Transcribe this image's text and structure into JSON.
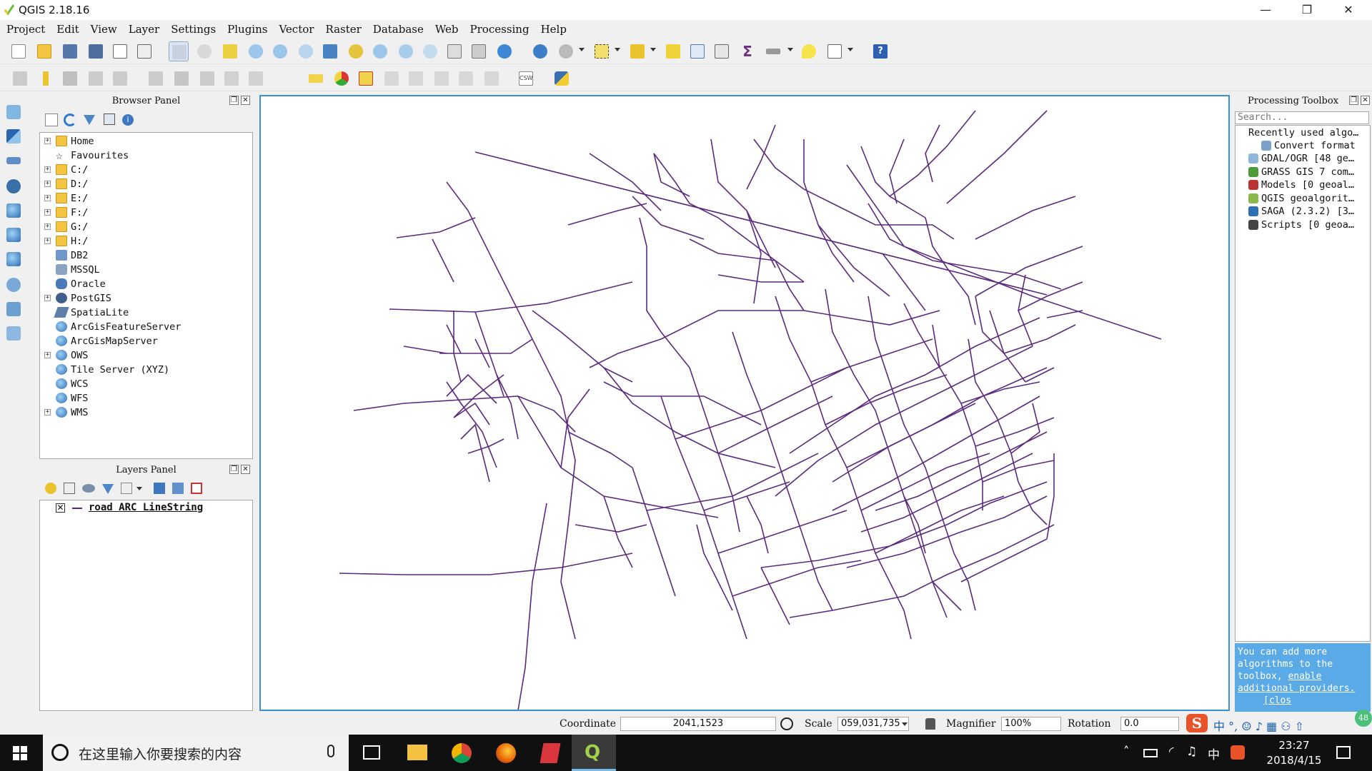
{
  "window": {
    "title": "QGIS 2.18.16",
    "minimize": "—",
    "maximize": "❐",
    "close": "✕"
  },
  "menu": [
    "Project",
    "Edit",
    "View",
    "Layer",
    "Settings",
    "Plugins",
    "Vector",
    "Raster",
    "Database",
    "Web",
    "Processing",
    "Help"
  ],
  "browser_panel": {
    "title": "Browser Panel",
    "items": [
      {
        "label": "Home",
        "icon": "folder-icon",
        "expand": true
      },
      {
        "label": "Favourites",
        "icon": "star-icon",
        "expand": false
      },
      {
        "label": "C:/",
        "icon": "folder-icon",
        "expand": true
      },
      {
        "label": "D:/",
        "icon": "folder-icon",
        "expand": true
      },
      {
        "label": "E:/",
        "icon": "folder-icon",
        "expand": true
      },
      {
        "label": "F:/",
        "icon": "folder-icon",
        "expand": true
      },
      {
        "label": "G:/",
        "icon": "folder-icon",
        "expand": true
      },
      {
        "label": "H:/",
        "icon": "folder-icon",
        "expand": true
      },
      {
        "label": "DB2",
        "icon": "db2-icon",
        "expand": false
      },
      {
        "label": "MSSQL",
        "icon": "mssql-icon",
        "expand": false
      },
      {
        "label": "Oracle",
        "icon": "oracle-icon",
        "expand": false
      },
      {
        "label": "PostGIS",
        "icon": "postgis-icon",
        "expand": true
      },
      {
        "label": "SpatiaLite",
        "icon": "spatialite-icon",
        "expand": false
      },
      {
        "label": "ArcGisFeatureServer",
        "icon": "globe-icon",
        "expand": false
      },
      {
        "label": "ArcGisMapServer",
        "icon": "globe-icon",
        "expand": false
      },
      {
        "label": "OWS",
        "icon": "globe-icon",
        "expand": true
      },
      {
        "label": "Tile Server (XYZ)",
        "icon": "globe-icon",
        "expand": false
      },
      {
        "label": "WCS",
        "icon": "globe-icon",
        "expand": false
      },
      {
        "label": "WFS",
        "icon": "wfs-icon",
        "expand": false
      },
      {
        "label": "WMS",
        "icon": "globe-icon",
        "expand": true
      }
    ]
  },
  "layers_panel": {
    "title": "Layers Panel",
    "layers": [
      {
        "label": "road ARC LineString",
        "visible": true,
        "color": "#6a2a86"
      }
    ]
  },
  "processing_toolbox": {
    "title": "Processing Toolbox",
    "search_placeholder": "Search...",
    "items": [
      {
        "label": "Recently used algo…",
        "expand": "−"
      },
      {
        "label": "Convert format",
        "expand": ""
      },
      {
        "label": "GDAL/OGR [48 ge…",
        "expand": "+"
      },
      {
        "label": "GRASS GIS 7 com…",
        "expand": "+"
      },
      {
        "label": "Models [0 geoal…",
        "expand": "+"
      },
      {
        "label": "QGIS geoalgorit…",
        "expand": "+"
      },
      {
        "label": "SAGA (2.3.2) [3…",
        "expand": "+"
      },
      {
        "label": "Scripts [0 geoa…",
        "expand": "+"
      }
    ],
    "info_text": "You can add more algorithms to the toolbox,",
    "info_link": "enable additional providers.",
    "info_close": "[clos"
  },
  "statusbar": {
    "coordinate_label": "Coordinate",
    "coordinate_value": "2041,1523",
    "scale_label": "Scale",
    "scale_value": "059,031,735",
    "magnifier_label": "Magnifier",
    "magnifier_value": "100%",
    "rotation_label": "Rotation",
    "rotation_value": "0.0",
    "badge": "48"
  },
  "taskbar": {
    "search_placeholder": "在这里输入你要搜索的内容",
    "time": "23:27",
    "date": "2018/4/15",
    "ime": "中"
  },
  "colors": {
    "road": "#5b2a7c",
    "canvas_border": "#3a8fd8",
    "info_bg": "#5aaae8"
  }
}
